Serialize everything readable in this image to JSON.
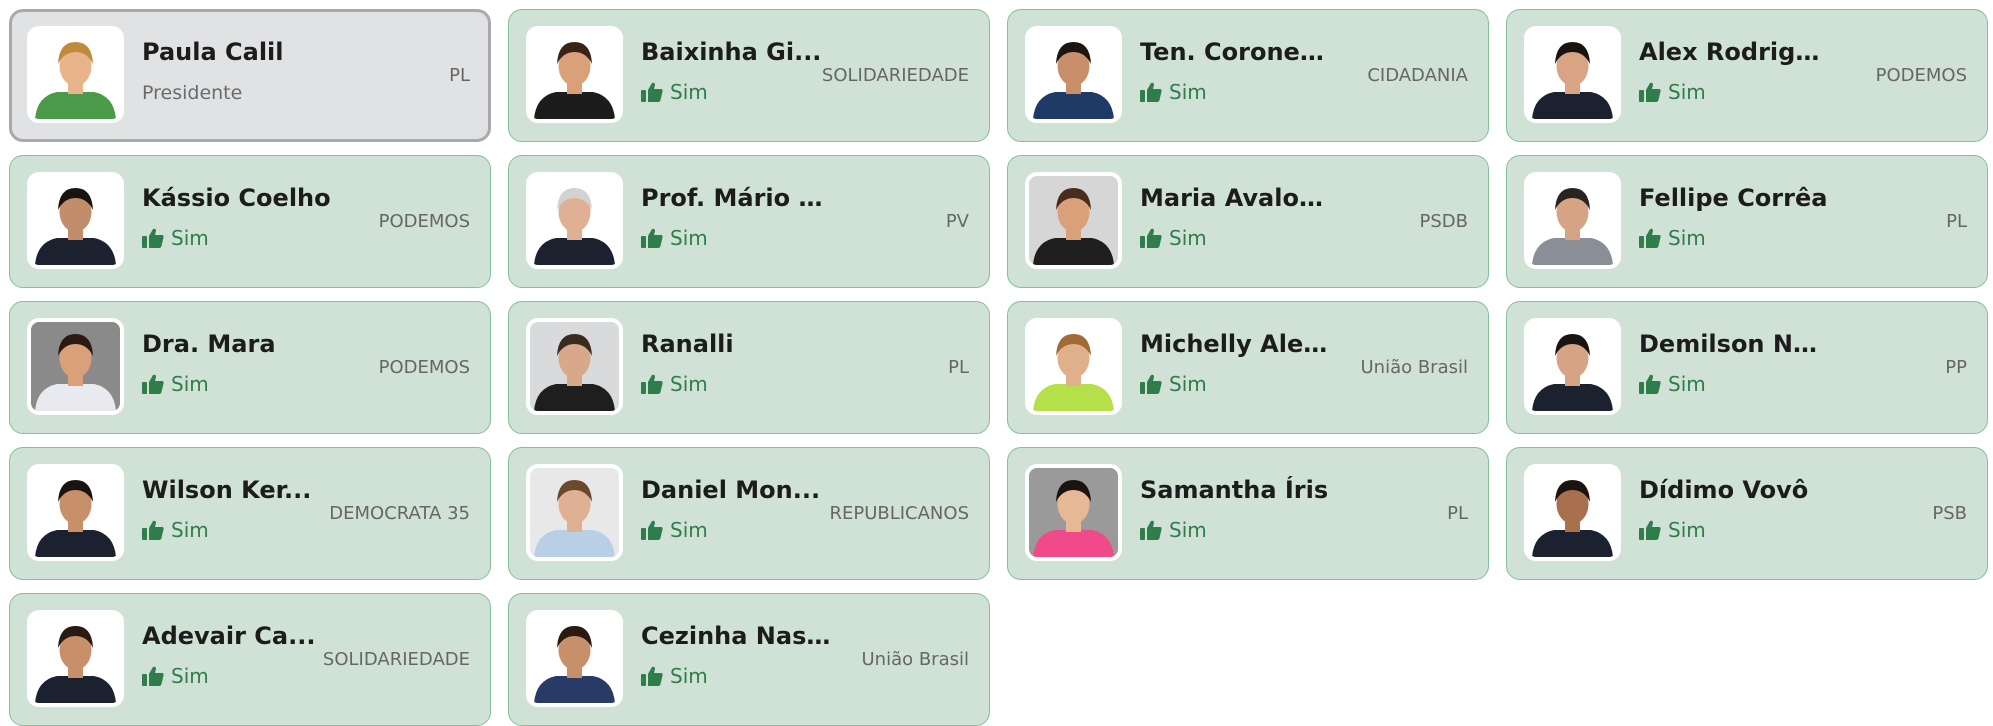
{
  "vote_label": "Sim",
  "colors": {
    "card_bg": "#d0e2d6",
    "card_border": "#86bf9a",
    "president_bg": "#e1e2e4",
    "president_border": "#a7a9ad",
    "vote_green": "#2e7d4a"
  },
  "members": [
    {
      "name": "Paula Calil",
      "role": "Presidente",
      "party": "PL",
      "president": true,
      "bg": "#ffffff",
      "shirt": "#4a9a4a",
      "skin": "#e8b48c",
      "hair": "#c08a3c"
    },
    {
      "name": "Baixinha Gi...",
      "party": "SOLIDARIEDADE",
      "bg": "#ffffff",
      "shirt": "#1c1c1c",
      "skin": "#d9a07a",
      "hair": "#3a2418"
    },
    {
      "name": "Ten. Coronel D...",
      "party": "CIDADANIA",
      "bg": "#ffffff",
      "shirt": "#1f3a66",
      "skin": "#c8906a",
      "hair": "#1e1410"
    },
    {
      "name": "Alex Rodrigues",
      "party": "PODEMOS",
      "bg": "#ffffff",
      "shirt": "#1c2130",
      "skin": "#d9a483",
      "hair": "#1a1410"
    },
    {
      "name": "Kássio Coelho",
      "party": "PODEMOS",
      "bg": "#ffffff",
      "shirt": "#1c2130",
      "skin": "#c28d6a",
      "hair": "#1a1410"
    },
    {
      "name": "Prof. Mário Nadaf",
      "party": "PV",
      "bg": "#ffffff",
      "shirt": "#1c2130",
      "skin": "#e0b094",
      "hair": "#d2d2d2"
    },
    {
      "name": "Maria Avalone",
      "party": "PSDB",
      "bg": "#d6d6d6",
      "shirt": "#1e1e1e",
      "skin": "#d9a07a",
      "hair": "#4a2c1c"
    },
    {
      "name": "Fellipe Corrêa",
      "party": "PL",
      "bg": "#ffffff",
      "shirt": "#8a8e96",
      "skin": "#d6a484",
      "hair": "#2a2420"
    },
    {
      "name": "Dra. Mara",
      "party": "PODEMOS",
      "bg": "#8a8a8a",
      "shirt": "#e8eaf0",
      "skin": "#d9a07a",
      "hair": "#2a1a12"
    },
    {
      "name": "Ranalli",
      "party": "PL",
      "bg": "#d8dadc",
      "shirt": "#1e1e1e",
      "skin": "#d8a88a",
      "hair": "#3a2a20"
    },
    {
      "name": "Michelly Alencar",
      "party": "União Brasil",
      "bg": "#ffffff",
      "shirt": "#b6e04a",
      "skin": "#e0b08c",
      "hair": "#a06c34"
    },
    {
      "name": "Demilson Nogueira",
      "party": "PP",
      "bg": "#ffffff",
      "shirt": "#1c2130",
      "skin": "#d6a484",
      "hair": "#1a1410"
    },
    {
      "name": "Wilson Ker...",
      "party": "DEMOCRATA 35",
      "bg": "#ffffff",
      "shirt": "#1c2130",
      "skin": "#c8906a",
      "hair": "#1a1410"
    },
    {
      "name": "Daniel Mon...",
      "party": "REPUBLICANOS",
      "bg": "#e8e8e8",
      "shirt": "#b8cfe6",
      "skin": "#e0b094",
      "hair": "#6a4a2a"
    },
    {
      "name": "Samantha Íris",
      "party": "PL",
      "bg": "#9a9a9a",
      "shirt": "#f04a8a",
      "skin": "#e6b896",
      "hair": "#1a1410"
    },
    {
      "name": "Dídimo Vovô",
      "party": "PSB",
      "bg": "#ffffff",
      "shirt": "#1c2130",
      "skin": "#a8704c",
      "hair": "#1a1410"
    },
    {
      "name": "Adevair Ca...",
      "party": "SOLIDARIEDADE",
      "bg": "#ffffff",
      "shirt": "#1c2130",
      "skin": "#c8906a",
      "hair": "#2a1a12"
    },
    {
      "name": "Cezinha Nasci...",
      "party": "União Brasil",
      "bg": "#ffffff",
      "shirt": "#2a3a66",
      "skin": "#c8906a",
      "hair": "#2a1a12"
    }
  ]
}
